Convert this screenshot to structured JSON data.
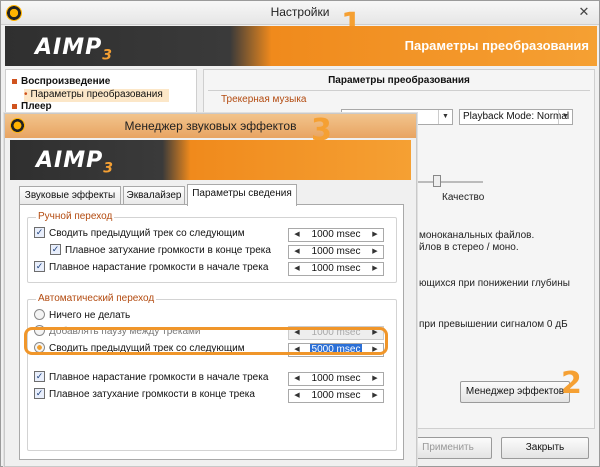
{
  "settings_window": {
    "title": "Настройки",
    "close_glyph": "✕",
    "callout_number": "1",
    "header_title": "Параметры преобразования",
    "logo": {
      "main": "AIMP",
      "sub": "3"
    },
    "tree": {
      "items": [
        {
          "label": "Воспроизведение",
          "bold": true
        },
        {
          "label": "Параметры преобразования",
          "selected": true
        },
        {
          "label": "Плеер",
          "bold": true
        }
      ]
    },
    "panel": {
      "title": "Параметры преобразования",
      "group_label": "Трекерная музыка",
      "playback_mode": "Playback Mode: Normal",
      "quality_label": "Качество",
      "text_mono": "моноканальных файлов.",
      "text_stereo": "йлов в стерео / моно.",
      "text_bits": "ющихся при понижении глубины",
      "text_clip": "при превышении сигналом 0 дБ",
      "effects_manager_button": "Менеджер эффектов",
      "callout_number": "2"
    },
    "buttons": {
      "apply": "Применить",
      "close": "Закрыть"
    }
  },
  "effects_window": {
    "title": "Менеджер звуковых эффектов",
    "callout_number": "3",
    "logo": {
      "main": "AIMP",
      "sub": "3"
    },
    "tabs": [
      "Звуковые эффекты",
      "Эквалайзер",
      "Параметры сведения"
    ],
    "active_tab": 2,
    "manual": {
      "label": "Ручной переход",
      "crossfade_label": "Сводить предыдущий трек со следующим",
      "crossfade_value": "1000 msec",
      "fadeout_label": "Плавное затухание громкости в конце трека",
      "fadeout_value": "1000 msec",
      "fadein_label": "Плавное нарастание громкости в начале трека",
      "fadein_value": "1000 msec"
    },
    "auto": {
      "label": "Автоматический переход",
      "nothing_label": "Ничего не делать",
      "pause_label": "Добавлять паузу между треками",
      "pause_value": "1000 msec",
      "crossfade_label": "Сводить предыдущий трек со следующим",
      "crossfade_value": "5000 msec",
      "fadein_label": "Плавное нарастание громкости в начале трека",
      "fadein_value": "1000 msec",
      "fadeout_label": "Плавное затухание громкости в конце трека",
      "fadeout_value": "1000 msec"
    }
  },
  "glyphs": {
    "check": "✓",
    "left": "◀",
    "right": "▶",
    "down": "▼"
  }
}
